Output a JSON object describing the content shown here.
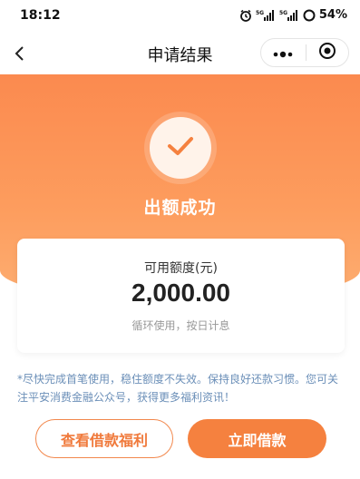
{
  "status_bar": {
    "time": "18:12",
    "battery": "54%"
  },
  "nav": {
    "title": "申请结果",
    "back_icon": "chevron-left-icon",
    "more_icon": "more-dots-icon",
    "close_icon": "mini-program-close-icon"
  },
  "hero": {
    "title": "出额成功",
    "icon": "check-icon"
  },
  "card": {
    "label": "可用额度(元)",
    "amount": "2,000.00",
    "note": "循环使用，按日计息"
  },
  "notice": "*尽快完成首笔使用，稳住额度不失效。保持良好还款习惯。您可关注平安消费金融公众号，获得更多福利资讯！",
  "buttons": {
    "secondary": "查看借款福利",
    "primary": "立即借款"
  },
  "colors": {
    "accent": "#f5813f",
    "hero_top": "#fb8a4f",
    "hero_bottom": "#fdae72",
    "notice_text": "#6b8fb8"
  }
}
